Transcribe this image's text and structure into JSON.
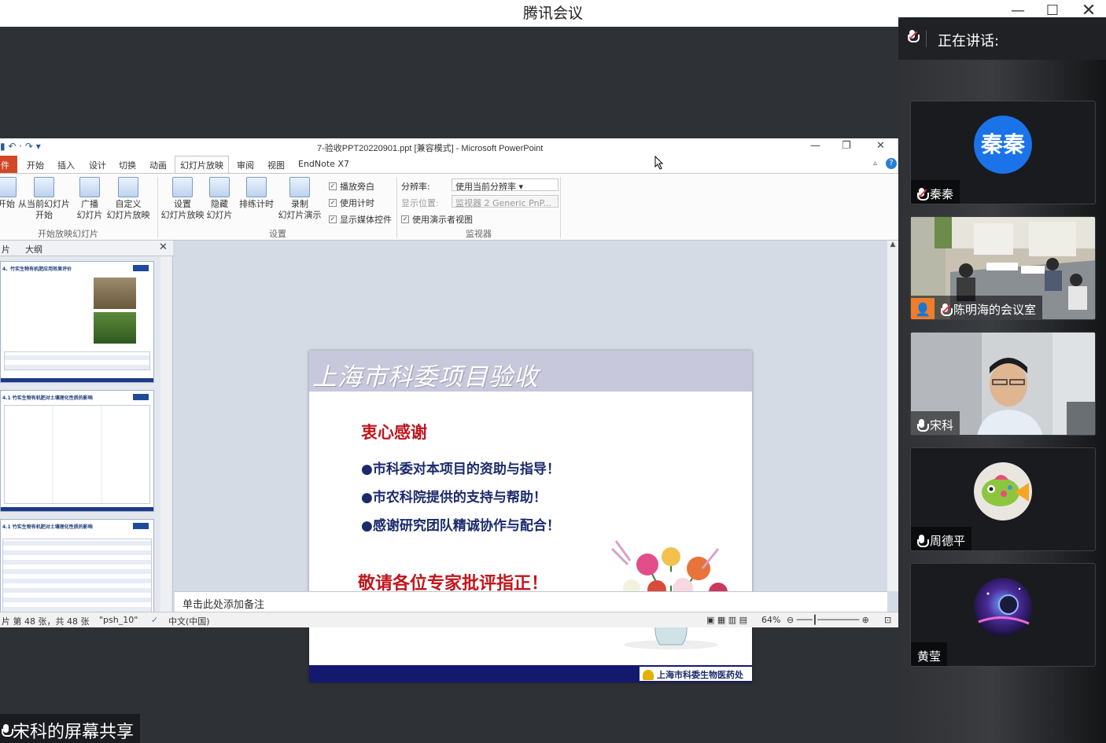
{
  "app": {
    "title": "腾讯会议"
  },
  "window_controls": {
    "minimize": "—",
    "maximize": "☐",
    "close": "✕"
  },
  "powerpoint": {
    "doc_title": "7-验收PPT20220901.ppt [兼容模式] - Microsoft PowerPoint",
    "tabs": [
      "件",
      "开始",
      "插入",
      "设计",
      "切换",
      "动画",
      "幻灯片放映",
      "审阅",
      "视图",
      "EndNote X7"
    ],
    "active_tab": "幻灯片放映",
    "ribbon": {
      "start_group": {
        "from_start": "开始",
        "from_current_line1": "从当前幻灯片",
        "from_current_line2": "开始",
        "broadcast_line1": "广播",
        "broadcast_line2": "幻灯片",
        "custom_line1": "自定义",
        "custom_line2": "幻灯片放映",
        "label": "开始放映幻灯片"
      },
      "setup_group": {
        "setup_line1": "设置",
        "setup_line2": "幻灯片放映",
        "hide_line1": "隐藏",
        "hide_line2": "幻灯片",
        "rehearse": "排练计时",
        "record_line1": "录制",
        "record_line2": "幻灯片演示",
        "play_narration": "播放旁白",
        "use_timings": "使用计时",
        "show_media": "显示媒体控件",
        "label": "设置"
      },
      "monitor_group": {
        "resolution_label": "分辨率:",
        "resolution_value": "使用当前分辨率",
        "show_on_label": "显示位置:",
        "show_on_value": "监视器 2  Generic PnP...",
        "presenter_view": "使用演示者视图",
        "label": "监视器"
      }
    },
    "pane_tabs": [
      "片",
      "大纲"
    ],
    "thumbnails": [
      {
        "title": "4、竹实生物有机肥应用效果评价"
      },
      {
        "title": "4.1 竹实生物有机肥对土壤理化性质的影响"
      },
      {
        "title": "4.1 竹实生物有机肥对土壤理化性质的影响"
      }
    ],
    "slide": {
      "header": "上海市科委项目验收",
      "thanks": "衷心感谢",
      "bullets": [
        "●市科委对本项目的资助与指导！",
        "●市农科院提供的支持与帮助！",
        "●感谢研究团队精诚协作与配合！"
      ],
      "request": "敬请各位专家批评指正！",
      "footer_org": "上海市科委生物医药处"
    },
    "notes_placeholder": "单击此处添加备注",
    "status": {
      "slide_info": "片 第 48 张，共 48 张",
      "theme": "\"psh_10\"",
      "language": "中文(中国)",
      "zoom": "64%"
    }
  },
  "side_panel": {
    "speaking_label": "正在讲话:",
    "participants": [
      {
        "name": "秦秦",
        "avatar_text": "秦秦",
        "avatar_color": "#1a73e8",
        "muted": true
      },
      {
        "name": "陈明海的会议室",
        "muted": true,
        "video": true
      },
      {
        "name": "宋科",
        "muted": false,
        "video": true
      },
      {
        "name": "周德平",
        "muted": false,
        "avatar_color": "#7bc043"
      },
      {
        "name": "黄莹",
        "muted": false,
        "avatar_color": "#1e1b5e"
      }
    ]
  },
  "share_label": "宋科的屏幕共享",
  "colors": {
    "accent_red": "#c0161c",
    "navy": "#1b2a6b",
    "meeting_blue": "#1a73e8"
  }
}
